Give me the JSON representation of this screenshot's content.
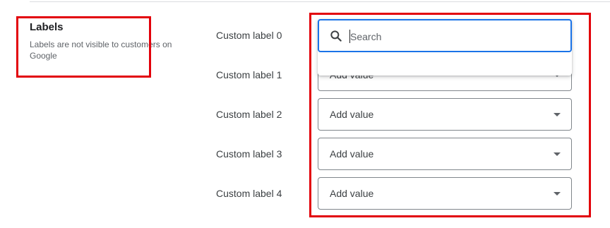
{
  "labels_section": {
    "title": "Labels",
    "description": "Labels are not visible to customers on Google"
  },
  "custom_labels": [
    {
      "label": "Custom label 0",
      "value": ""
    },
    {
      "label": "Custom label 1",
      "value": "Add value"
    },
    {
      "label": "Custom label 2",
      "value": "Add value"
    },
    {
      "label": "Custom label 3",
      "value": "Add value"
    },
    {
      "label": "Custom label 4",
      "value": "Add value"
    }
  ],
  "dropdown": {
    "search_placeholder": "Search",
    "search_icon": "search-icon"
  },
  "colors": {
    "highlight_border": "#e2000a",
    "focus_blue": "#1a73e8",
    "field_border": "#80868b"
  }
}
